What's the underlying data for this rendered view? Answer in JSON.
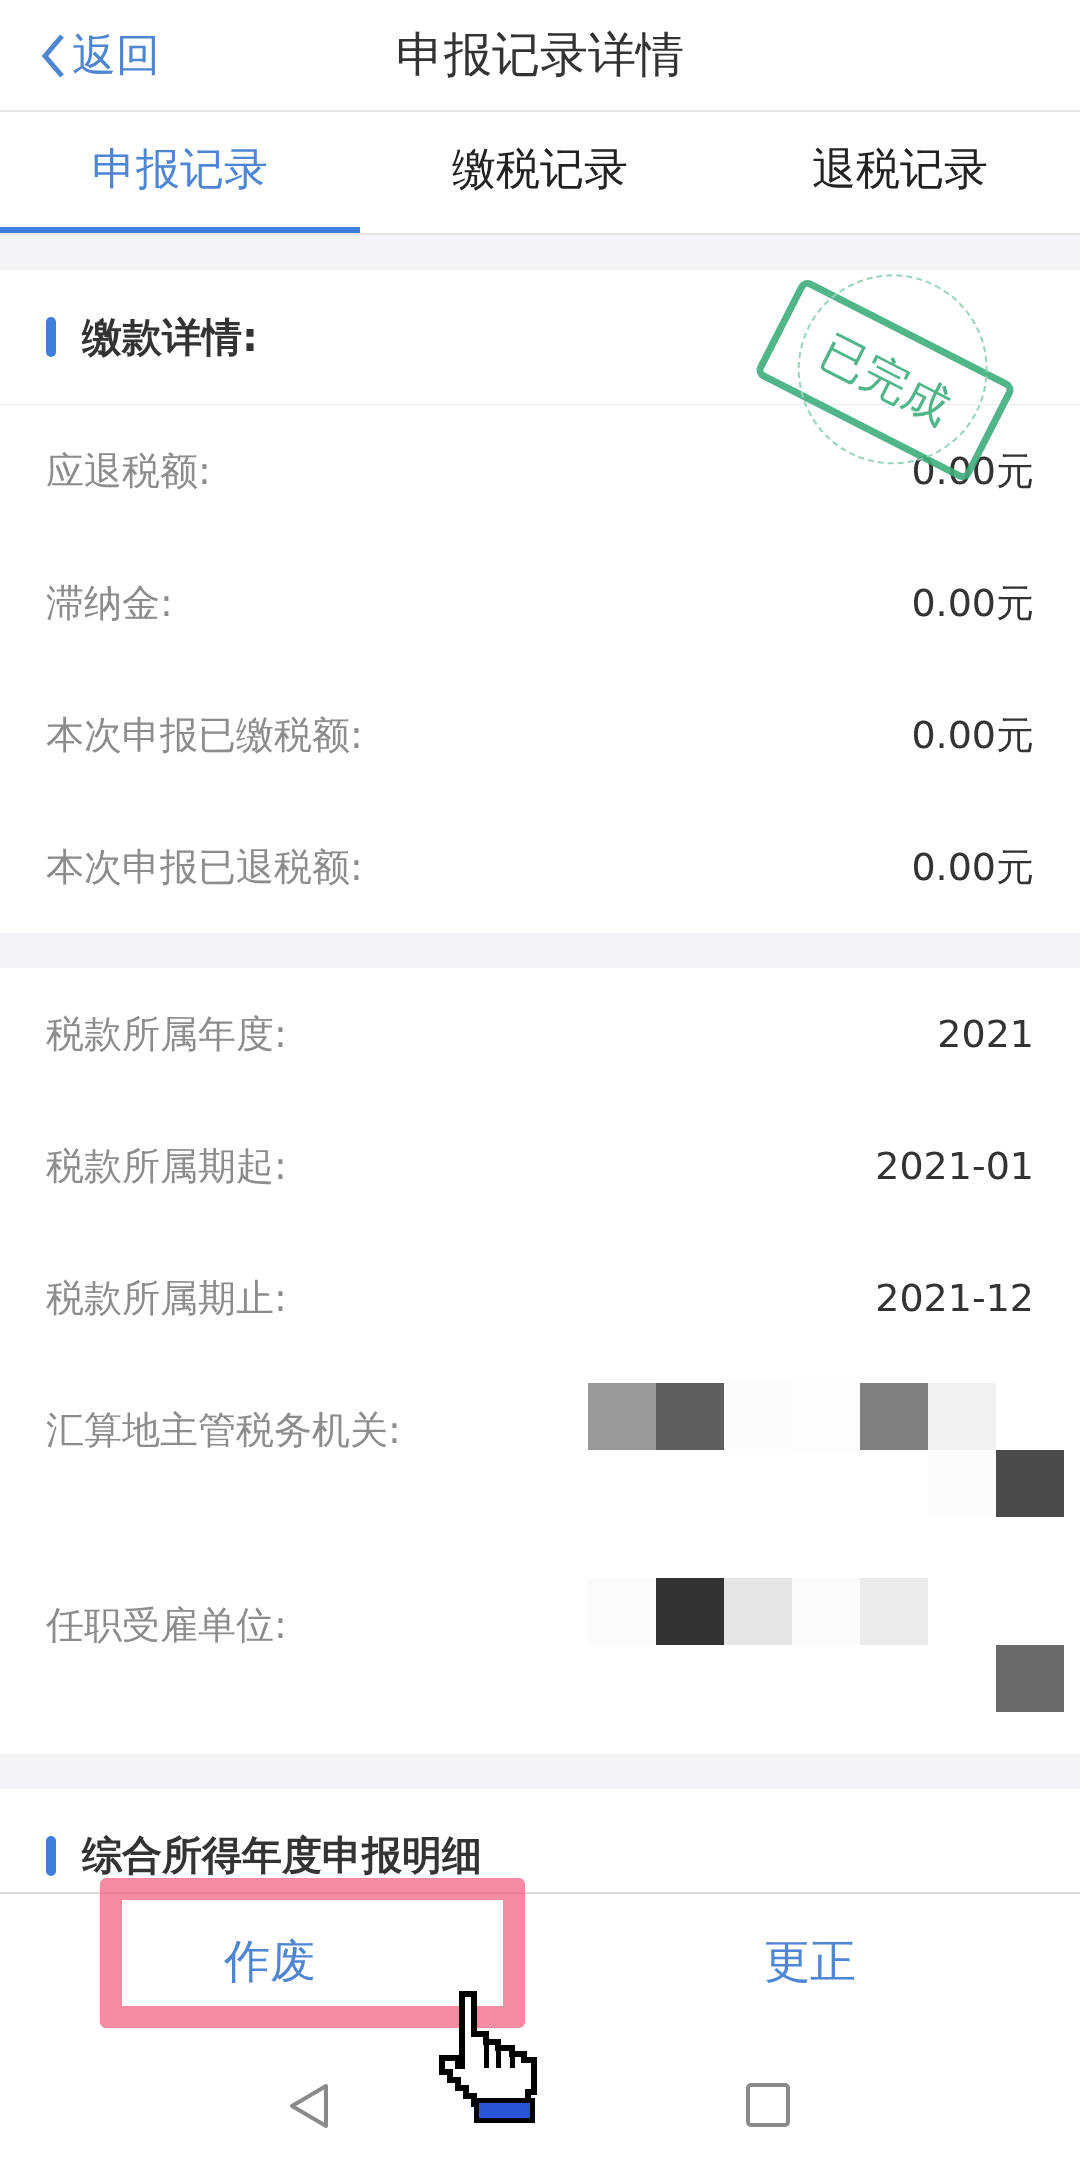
{
  "header": {
    "back": "返回",
    "title": "申报记录详情"
  },
  "tabs": [
    {
      "label": "申报记录",
      "selected": true
    },
    {
      "label": "缴税记录",
      "selected": false
    },
    {
      "label": "退税记录",
      "selected": false
    }
  ],
  "sections": [
    {
      "title": "缴款详情:",
      "stamp": "已完成",
      "rows": [
        {
          "kind": "text",
          "label": "应退税额:",
          "value": "0.00元"
        },
        {
          "kind": "text",
          "label": "滞纳金:",
          "value": "0.00元"
        },
        {
          "kind": "text",
          "label": "本次申报已缴税额:",
          "value": "0.00元"
        },
        {
          "kind": "text",
          "label": "本次申报已退税额:",
          "value": "0.00元"
        }
      ]
    },
    {
      "rows": [
        {
          "kind": "text",
          "label": "税款所属年度:",
          "value": "2021"
        },
        {
          "kind": "text",
          "label": "税款所属期起:",
          "value": "2021-01"
        },
        {
          "kind": "text",
          "label": "税款所属期止:",
          "value": "2021-12"
        },
        {
          "kind": "redacted",
          "label": "汇算地主管税务机关:"
        },
        {
          "kind": "redacted",
          "label": "任职受雇单位:"
        }
      ]
    },
    {
      "title": "综合所得年度申报明细"
    }
  ],
  "actions": [
    {
      "label": "作废",
      "highlighted": true
    },
    {
      "label": "更正",
      "highlighted": false
    }
  ]
}
